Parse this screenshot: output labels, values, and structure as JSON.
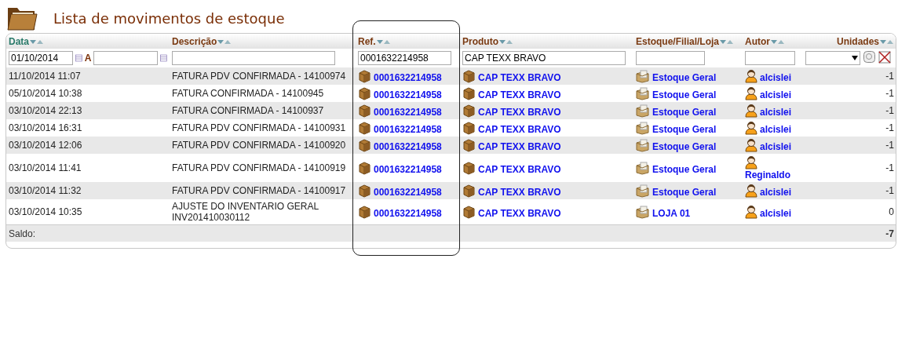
{
  "page": {
    "title": "Lista de movimentos de estoque"
  },
  "columns": [
    {
      "label": "Data",
      "sorted": true,
      "highlighted": false
    },
    {
      "label": "Descrição",
      "sorted": false,
      "highlighted": false
    },
    {
      "label": "Ref.",
      "sorted": false,
      "highlighted": true
    },
    {
      "label": "Produto",
      "sorted": false,
      "highlighted": false
    },
    {
      "label": "Estoque/Filial/Loja",
      "sorted": false,
      "highlighted": false
    },
    {
      "label": "Autor",
      "sorted": false,
      "highlighted": false
    },
    {
      "label": "Unidades",
      "sorted": false,
      "highlighted": false
    }
  ],
  "filters": {
    "date_from": "01/10/2014",
    "range_separator": "A",
    "ref": "0001632214958",
    "product": "CAP TEXX BRAVO"
  },
  "rows": [
    {
      "date": "11/10/2014 11:07",
      "description": "FATURA PDV CONFIRMADA - 14100974",
      "ref": "0001632214958",
      "product": "CAP TEXX BRAVO",
      "stock": "Estoque Geral",
      "author": "alcislei",
      "units": "-1"
    },
    {
      "date": "05/10/2014 10:38",
      "description": "FATURA CONFIRMADA - 14100945",
      "ref": "0001632214958",
      "product": "CAP TEXX BRAVO",
      "stock": "Estoque Geral",
      "author": "alcislei",
      "units": "-1"
    },
    {
      "date": "03/10/2014 22:13",
      "description": "FATURA CONFIRMADA - 14100937",
      "ref": "0001632214958",
      "product": "CAP TEXX BRAVO",
      "stock": "Estoque Geral",
      "author": "alcislei",
      "units": "-1"
    },
    {
      "date": "03/10/2014 16:31",
      "description": "FATURA PDV CONFIRMADA - 14100931",
      "ref": "0001632214958",
      "product": "CAP TEXX BRAVO",
      "stock": "Estoque Geral",
      "author": "alcislei",
      "units": "-1"
    },
    {
      "date": "03/10/2014 12:06",
      "description": "FATURA PDV CONFIRMADA - 14100920",
      "ref": "0001632214958",
      "product": "CAP TEXX BRAVO",
      "stock": "Estoque Geral",
      "author": "alcislei",
      "units": "-1"
    },
    {
      "date": "03/10/2014 11:41",
      "description": "FATURA PDV CONFIRMADA - 14100919",
      "ref": "0001632214958",
      "product": "CAP TEXX BRAVO",
      "stock": "Estoque Geral",
      "author": "Reginaldo",
      "units": "-1"
    },
    {
      "date": "03/10/2014 11:32",
      "description": "FATURA PDV CONFIRMADA - 14100917",
      "ref": "0001632214958",
      "product": "CAP TEXX BRAVO",
      "stock": "Estoque Geral",
      "author": "alcislei",
      "units": "-1"
    },
    {
      "date": "03/10/2014 10:35",
      "description": "AJUSTE DO INVENTARIO GERAL INV201410030112",
      "ref": "0001632214958",
      "product": "CAP TEXX BRAVO",
      "stock": "LOJA 01",
      "author": "alcislei",
      "units": "0"
    }
  ],
  "footer": {
    "label": "Saldo:",
    "total": "-7"
  }
}
